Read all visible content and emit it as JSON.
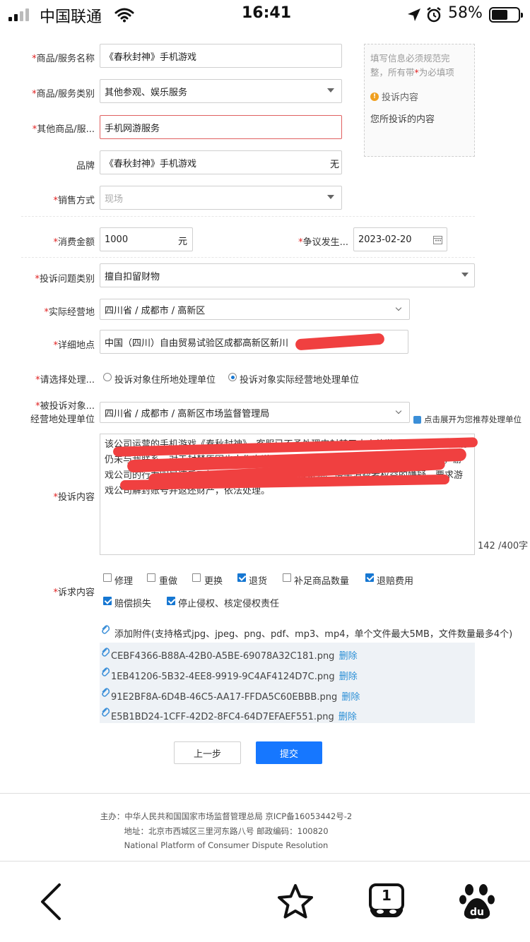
{
  "status_bar": {
    "carrier": "中国联通",
    "time": "16:41",
    "battery": "58%"
  },
  "form": {
    "product_name": {
      "label": "商品/服务名称",
      "value": "《春秋封神》手机游戏"
    },
    "product_category": {
      "label": "商品/服务类别",
      "value": "其他参观、娱乐服务"
    },
    "other_product": {
      "label": "其他商品/服...",
      "value": "手机网游服务"
    },
    "brand": {
      "label": "品牌",
      "value": "《春秋封神》手机游戏",
      "suffix": "无"
    },
    "sales_method": {
      "label": "销售方式",
      "placeholder": "现场"
    },
    "amount": {
      "label": "消费金额",
      "value": "1000",
      "unit": "元"
    },
    "dispute_date": {
      "label": "争议发生...",
      "value": "2023-02-20"
    },
    "complaint_type": {
      "label": "投诉问题类别",
      "value": "擅自扣留财物"
    },
    "business_location": {
      "label": "实际经营地",
      "value": "四川省 / 成都市 / 高新区"
    },
    "detail_address": {
      "label": "详细地点",
      "value": "中国（四川）自由贸易试验区成都高新区新川"
    },
    "handler_choice": {
      "label": "请选择处理...",
      "options": [
        "投诉对象住所地处理单位",
        "投诉对象实际经营地处理单位"
      ],
      "selected_index": 1
    },
    "handler_unit": {
      "label_line1": "被投诉对象...",
      "label_line2": "经营地处理单位",
      "value": "四川省 / 成都市 / 高新区市场监督管理局",
      "expand_hint": "点击展开为您推荐处理单位"
    },
    "complaint_content": {
      "label": "投诉内容",
      "text": "该公司运营的手机游戏《春秋封神》，客服已不予处理申封禁了本人的游戏账号，截止目前仍未与我联系，对于封禁原因也未作出说明，账号内仍有大量已充值消费的100多元，游戏公司的行为明显违反了相关规定，存在擅自扣留财物、侵害消费者权益的嫌疑，要求游戏公司解封账号并返还财产，依法处理。",
      "count": "142",
      "limit": "/400字"
    },
    "demands": {
      "label": "诉求内容",
      "options": [
        {
          "text": "修理",
          "checked": false
        },
        {
          "text": "重做",
          "checked": false
        },
        {
          "text": "更换",
          "checked": false
        },
        {
          "text": "退货",
          "checked": true
        },
        {
          "text": "补足商品数量",
          "checked": false
        },
        {
          "text": "退赔费用",
          "checked": true
        },
        {
          "text": "赔偿损失",
          "checked": true
        },
        {
          "text": "停止侵权、核定侵权责任",
          "checked": true
        }
      ]
    },
    "attachments": {
      "add_label": "添加附件(支持格式jpg、jpeg、png、pdf、mp3、mp4，单个文件最大5MB，文件数量最多4个)",
      "files": [
        "CEBF4366-B88A-42B0-A5BE-69078A32C181.png",
        "1EB41206-5B32-4EE8-9919-9C4AF4124D7C.png",
        "91E2BF8A-6D4B-46C5-AA17-FFDA5C60EBBB.png",
        "E5B1BD24-1CFF-42D2-8FC4-64D7EFAEF551.png"
      ],
      "delete_label": "删除"
    },
    "buttons": {
      "prev": "上一步",
      "submit": "提交"
    }
  },
  "tip": {
    "text_line1": "填写信息必须规范完",
    "text_line2a": "整，所有带",
    "text_star": "*",
    "text_line2b": "为必填项",
    "title": "投诉内容",
    "desc": "您所投诉的内容"
  },
  "footer": {
    "line1": "主办：中华人民共和国国家市场监督管理总局 京ICP备16053442号-2",
    "line2": "地址：北京市西城区三里河东路八号 邮政编码：100820",
    "line3": "National Platform of Consumer Dispute Resolution"
  },
  "browser_bar": {
    "icons": [
      "back-icon",
      "star-icon",
      "tabs-icon",
      "baidu-icon"
    ],
    "tab_count": "1"
  }
}
